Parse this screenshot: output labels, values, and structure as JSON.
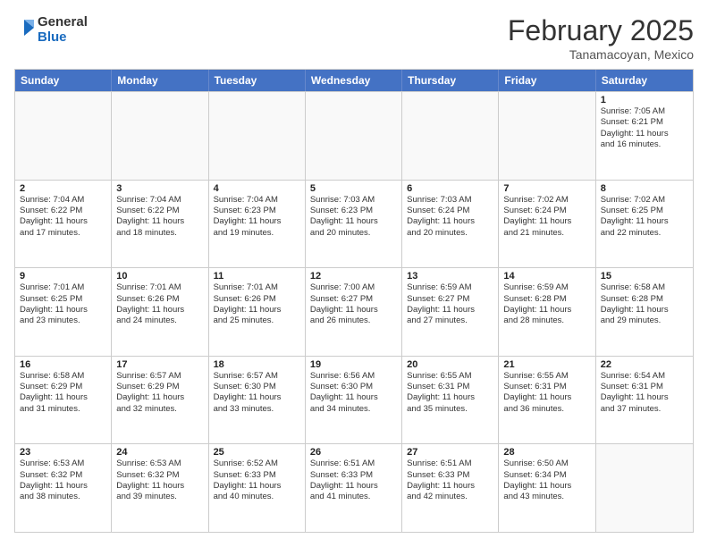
{
  "header": {
    "logo_general": "General",
    "logo_blue": "Blue",
    "month": "February 2025",
    "location": "Tanamacoyan, Mexico"
  },
  "weekdays": [
    "Sunday",
    "Monday",
    "Tuesday",
    "Wednesday",
    "Thursday",
    "Friday",
    "Saturday"
  ],
  "weeks": [
    [
      {
        "day": "",
        "info": ""
      },
      {
        "day": "",
        "info": ""
      },
      {
        "day": "",
        "info": ""
      },
      {
        "day": "",
        "info": ""
      },
      {
        "day": "",
        "info": ""
      },
      {
        "day": "",
        "info": ""
      },
      {
        "day": "1",
        "info": "Sunrise: 7:05 AM\nSunset: 6:21 PM\nDaylight: 11 hours\nand 16 minutes."
      }
    ],
    [
      {
        "day": "2",
        "info": "Sunrise: 7:04 AM\nSunset: 6:22 PM\nDaylight: 11 hours\nand 17 minutes."
      },
      {
        "day": "3",
        "info": "Sunrise: 7:04 AM\nSunset: 6:22 PM\nDaylight: 11 hours\nand 18 minutes."
      },
      {
        "day": "4",
        "info": "Sunrise: 7:04 AM\nSunset: 6:23 PM\nDaylight: 11 hours\nand 19 minutes."
      },
      {
        "day": "5",
        "info": "Sunrise: 7:03 AM\nSunset: 6:23 PM\nDaylight: 11 hours\nand 20 minutes."
      },
      {
        "day": "6",
        "info": "Sunrise: 7:03 AM\nSunset: 6:24 PM\nDaylight: 11 hours\nand 20 minutes."
      },
      {
        "day": "7",
        "info": "Sunrise: 7:02 AM\nSunset: 6:24 PM\nDaylight: 11 hours\nand 21 minutes."
      },
      {
        "day": "8",
        "info": "Sunrise: 7:02 AM\nSunset: 6:25 PM\nDaylight: 11 hours\nand 22 minutes."
      }
    ],
    [
      {
        "day": "9",
        "info": "Sunrise: 7:01 AM\nSunset: 6:25 PM\nDaylight: 11 hours\nand 23 minutes."
      },
      {
        "day": "10",
        "info": "Sunrise: 7:01 AM\nSunset: 6:26 PM\nDaylight: 11 hours\nand 24 minutes."
      },
      {
        "day": "11",
        "info": "Sunrise: 7:01 AM\nSunset: 6:26 PM\nDaylight: 11 hours\nand 25 minutes."
      },
      {
        "day": "12",
        "info": "Sunrise: 7:00 AM\nSunset: 6:27 PM\nDaylight: 11 hours\nand 26 minutes."
      },
      {
        "day": "13",
        "info": "Sunrise: 6:59 AM\nSunset: 6:27 PM\nDaylight: 11 hours\nand 27 minutes."
      },
      {
        "day": "14",
        "info": "Sunrise: 6:59 AM\nSunset: 6:28 PM\nDaylight: 11 hours\nand 28 minutes."
      },
      {
        "day": "15",
        "info": "Sunrise: 6:58 AM\nSunset: 6:28 PM\nDaylight: 11 hours\nand 29 minutes."
      }
    ],
    [
      {
        "day": "16",
        "info": "Sunrise: 6:58 AM\nSunset: 6:29 PM\nDaylight: 11 hours\nand 31 minutes."
      },
      {
        "day": "17",
        "info": "Sunrise: 6:57 AM\nSunset: 6:29 PM\nDaylight: 11 hours\nand 32 minutes."
      },
      {
        "day": "18",
        "info": "Sunrise: 6:57 AM\nSunset: 6:30 PM\nDaylight: 11 hours\nand 33 minutes."
      },
      {
        "day": "19",
        "info": "Sunrise: 6:56 AM\nSunset: 6:30 PM\nDaylight: 11 hours\nand 34 minutes."
      },
      {
        "day": "20",
        "info": "Sunrise: 6:55 AM\nSunset: 6:31 PM\nDaylight: 11 hours\nand 35 minutes."
      },
      {
        "day": "21",
        "info": "Sunrise: 6:55 AM\nSunset: 6:31 PM\nDaylight: 11 hours\nand 36 minutes."
      },
      {
        "day": "22",
        "info": "Sunrise: 6:54 AM\nSunset: 6:31 PM\nDaylight: 11 hours\nand 37 minutes."
      }
    ],
    [
      {
        "day": "23",
        "info": "Sunrise: 6:53 AM\nSunset: 6:32 PM\nDaylight: 11 hours\nand 38 minutes."
      },
      {
        "day": "24",
        "info": "Sunrise: 6:53 AM\nSunset: 6:32 PM\nDaylight: 11 hours\nand 39 minutes."
      },
      {
        "day": "25",
        "info": "Sunrise: 6:52 AM\nSunset: 6:33 PM\nDaylight: 11 hours\nand 40 minutes."
      },
      {
        "day": "26",
        "info": "Sunrise: 6:51 AM\nSunset: 6:33 PM\nDaylight: 11 hours\nand 41 minutes."
      },
      {
        "day": "27",
        "info": "Sunrise: 6:51 AM\nSunset: 6:33 PM\nDaylight: 11 hours\nand 42 minutes."
      },
      {
        "day": "28",
        "info": "Sunrise: 6:50 AM\nSunset: 6:34 PM\nDaylight: 11 hours\nand 43 minutes."
      },
      {
        "day": "",
        "info": ""
      }
    ]
  ]
}
